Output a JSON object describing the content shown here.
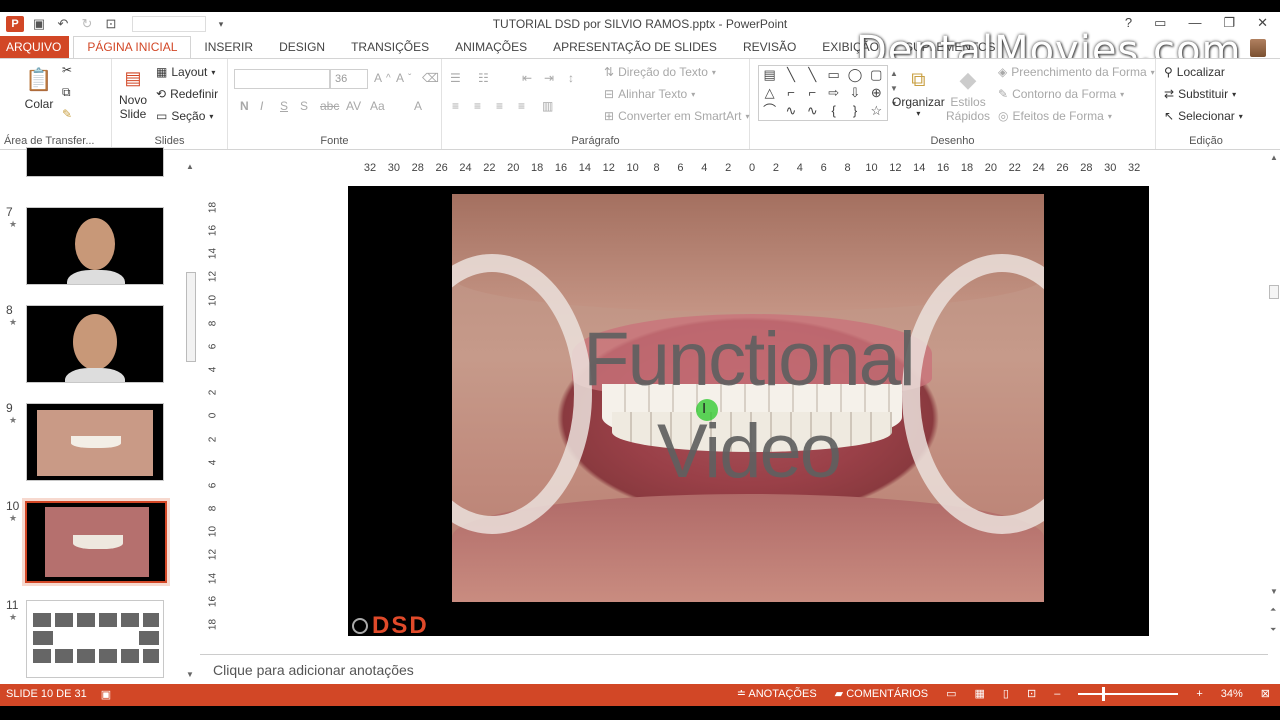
{
  "window": {
    "title": "TUTORIAL DSD por SILVIO RAMOS.pptx - PowerPoint",
    "help": "?",
    "watermark": "DentalMovies.com"
  },
  "tabs": [
    "ARQUIVO",
    "PÁGINA INICIAL",
    "INSERIR",
    "DESIGN",
    "TRANSIÇÕES",
    "ANIMAÇÕES",
    "APRESENTAÇÃO DE SLIDES",
    "REVISÃO",
    "EXIBIÇÃO",
    "SUPLEMENTOS"
  ],
  "ribbon": {
    "clipboard": {
      "paste": "Colar",
      "label": "Área de Transfer..."
    },
    "slides": {
      "new_slide_1": "Novo",
      "new_slide_2": "Slide",
      "layout": "Layout",
      "reset": "Redefinir",
      "section": "Seção",
      "label": "Slides"
    },
    "font": {
      "size": "36",
      "bold": "N",
      "italic": "I",
      "underline": "S",
      "strike": "S",
      "label": "Fonte"
    },
    "paragraph": {
      "text_direction": "Direção do Texto",
      "align_text": "Alinhar Texto",
      "smartart": "Converter em SmartArt",
      "label": "Parágrafo"
    },
    "drawing": {
      "arrange": "Organizar",
      "quick_styles_1": "Estilos",
      "quick_styles_2": "Rápidos",
      "fill": "Preenchimento da Forma",
      "outline": "Contorno da Forma",
      "effects": "Efeitos de Forma",
      "label": "Desenho"
    },
    "editing": {
      "find": "Localizar",
      "replace": "Substituir",
      "select": "Selecionar",
      "label": "Edição"
    }
  },
  "thumbnails": [
    {
      "num": "7"
    },
    {
      "num": "8"
    },
    {
      "num": "9"
    },
    {
      "num": "10"
    },
    {
      "num": "11"
    }
  ],
  "ruler_h": [
    "32",
    "30",
    "28",
    "26",
    "24",
    "22",
    "20",
    "18",
    "16",
    "14",
    "12",
    "10",
    "8",
    "6",
    "4",
    "2",
    "0",
    "2",
    "4",
    "6",
    "8",
    "10",
    "12",
    "14",
    "16",
    "18",
    "20",
    "22",
    "24",
    "26",
    "28",
    "30",
    "32"
  ],
  "ruler_v": [
    "18",
    "16",
    "14",
    "12",
    "10",
    "8",
    "6",
    "4",
    "2",
    "0",
    "2",
    "4",
    "6",
    "8",
    "10",
    "12",
    "14",
    "16",
    "18"
  ],
  "slide": {
    "title_1": "Functional",
    "title_2": "Video",
    "logo": "DSD"
  },
  "notes_placeholder": "Clique para adicionar anotações",
  "status": {
    "slide_info": "SLIDE 10 DE 31",
    "notes": "ANOTAÇÕES",
    "comments": "COMENTÁRIOS",
    "zoom": "34%"
  },
  "colors": {
    "accent": "#d24726"
  }
}
